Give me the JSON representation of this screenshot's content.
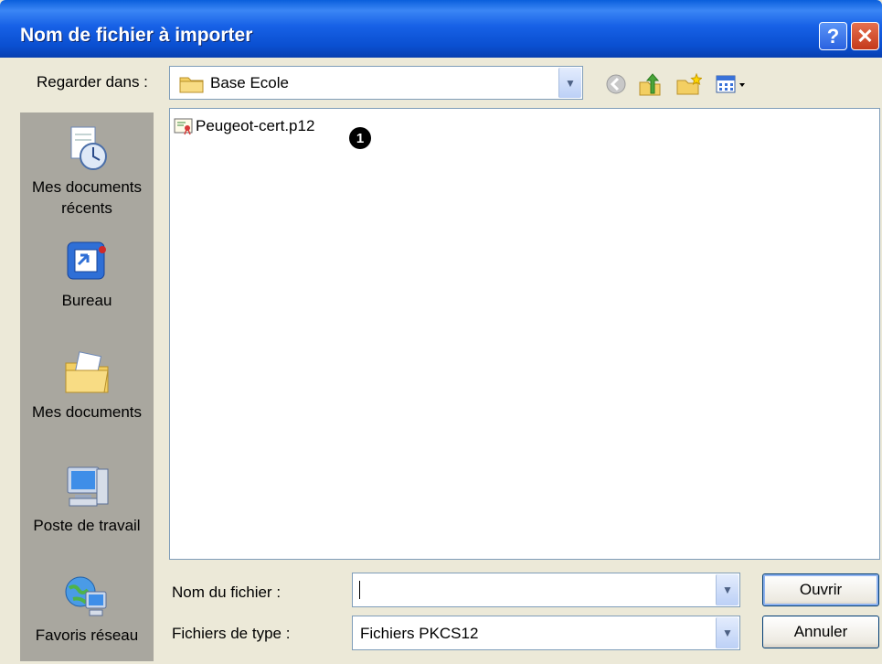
{
  "dialog": {
    "title": "Nom de fichier à importer",
    "help_label": "?",
    "close_label": "✕"
  },
  "lookin": {
    "label": "Regarder dans :",
    "value": "Base Ecole"
  },
  "toolbar": {
    "icons": [
      "back-icon",
      "up-folder-icon",
      "new-folder-icon",
      "view-menu-icon"
    ]
  },
  "places": [
    {
      "label": "Mes documents\nrécents",
      "icon": "recent-documents-icon"
    },
    {
      "label": "Bureau",
      "icon": "desktop-icon"
    },
    {
      "label": "Mes documents",
      "icon": "my-documents-icon"
    },
    {
      "label": "Poste de travail",
      "icon": "my-computer-icon"
    },
    {
      "label": "Favoris réseau",
      "icon": "network-places-icon"
    }
  ],
  "files": [
    {
      "name": "Peugeot-cert.p12",
      "icon": "certificate-file-icon"
    }
  ],
  "callout": "1",
  "filename": {
    "label": "Nom du fichier :",
    "value": ""
  },
  "filetype": {
    "label": "Fichiers de type :",
    "value": "Fichiers PKCS12"
  },
  "buttons": {
    "open": "Ouvrir",
    "cancel": "Annuler"
  }
}
